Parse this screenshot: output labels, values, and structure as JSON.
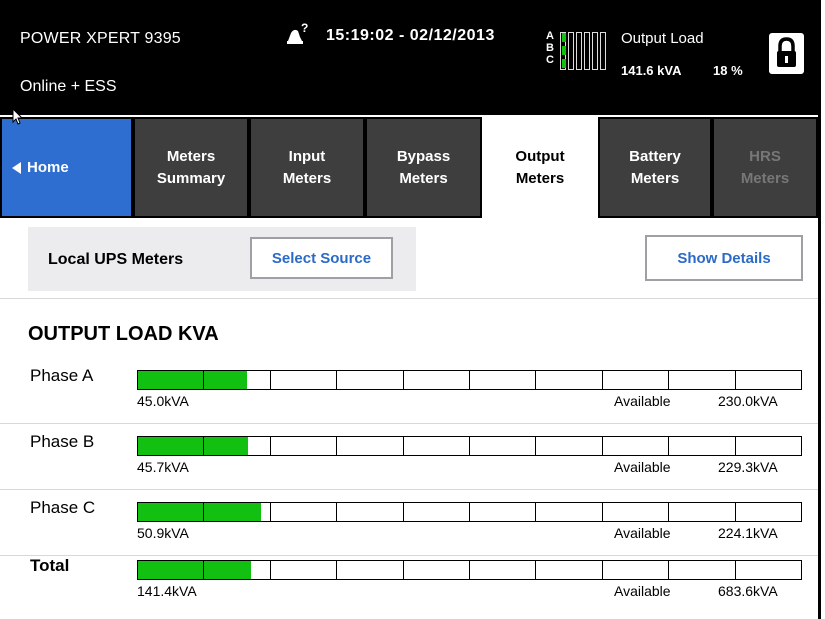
{
  "header": {
    "device_name": "POWER XPERT 9395",
    "mode": "Online + ESS",
    "datetime": "15:19:02 - 02/12/2013",
    "alarm_badge": "?",
    "phase_letters": [
      "A",
      "B",
      "C"
    ],
    "output_label": "Output Load",
    "output_kva": "141.6 kVA",
    "output_percent": "18 %",
    "icons": {
      "alarm": "alarm-bell-icon",
      "lock": "lock-icon"
    }
  },
  "tabs": [
    {
      "label": "Home",
      "icon": "left-triangle-icon",
      "state": "home"
    },
    {
      "label": "Meters\nSummary",
      "state": "normal"
    },
    {
      "label": "Input\nMeters",
      "state": "normal"
    },
    {
      "label": "Bypass\nMeters",
      "state": "normal"
    },
    {
      "label": "Output\nMeters",
      "state": "active"
    },
    {
      "label": "Battery\nMeters",
      "state": "normal"
    },
    {
      "label": "HRS\nMeters",
      "state": "disabled"
    }
  ],
  "source": {
    "label": "Local UPS Meters",
    "select_button": "Select Source",
    "details_button": "Show Details"
  },
  "section_title": "OUTPUT LOAD KVA",
  "meters": {
    "segments": 10,
    "available_label": "Available",
    "rows": [
      {
        "label": "Phase A",
        "value": "45.0kVA",
        "available": "230.0kVA",
        "fill_fraction": 0.164
      },
      {
        "label": "Phase B",
        "value": "45.7kVA",
        "available": "229.3kVA",
        "fill_fraction": 0.166
      },
      {
        "label": "Phase C",
        "value": "50.9kVA",
        "available": "224.1kVA",
        "fill_fraction": 0.185
      },
      {
        "label": "Total",
        "value": "141.4kVA",
        "available": "683.6kVA",
        "fill_fraction": 0.171
      }
    ]
  },
  "colors": {
    "header_bg": "#000000",
    "home_tab": "#2f6ed1",
    "tab_bg": "#3e3e3e",
    "button_text": "#2b6ac7",
    "bar_fill": "#11c010"
  }
}
